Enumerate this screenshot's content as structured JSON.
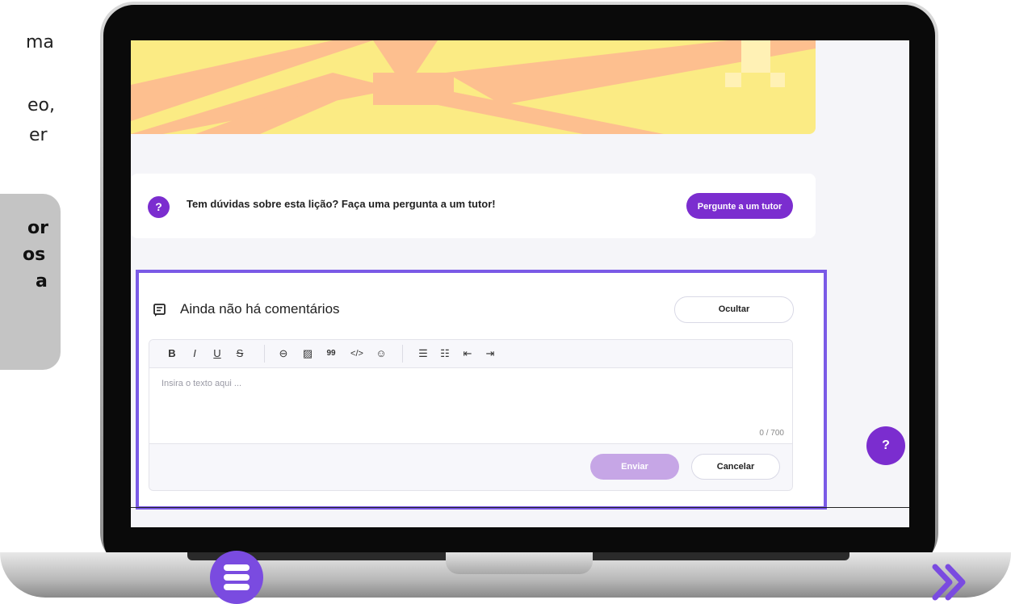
{
  "left_panel": {
    "lines": [
      "ma",
      "eo,",
      "er"
    ],
    "card_lines": [
      "or",
      "os",
      "a"
    ]
  },
  "tutor": {
    "icon": "?",
    "text": "Tem dúvidas sobre esta lição? Faça uma pergunta a um tutor!",
    "button": "Pergunte a um tutor"
  },
  "comments": {
    "title": "Ainda não há comentários",
    "hide_button": "Ocultar",
    "toolbar": [
      "B",
      "I",
      "U",
      "S",
      "link",
      "image",
      "quote",
      "code",
      "emoji",
      "bullet-list",
      "numbered-list",
      "outdent",
      "indent"
    ],
    "toolbar_symbols": {
      "bold": "B",
      "italic": "I",
      "underline": "U",
      "strike": "S",
      "link": "⊖",
      "image": "▨",
      "quote": "99",
      "code": "</>",
      "emoji": "☺",
      "bullet": "☰",
      "numbered": "☷",
      "outdent": "⇤",
      "indent": "⇥"
    },
    "placeholder": "Insira o texto aqui ...",
    "counter": "0 / 700",
    "send_button": "Enviar",
    "cancel_button": "Cancelar"
  },
  "help_fab": "?",
  "colors": {
    "accent": "#7b2dcf",
    "frame": "#7a5ae6",
    "banner_yellow": "#fbeb84",
    "banner_orange": "#fdbf8f"
  }
}
